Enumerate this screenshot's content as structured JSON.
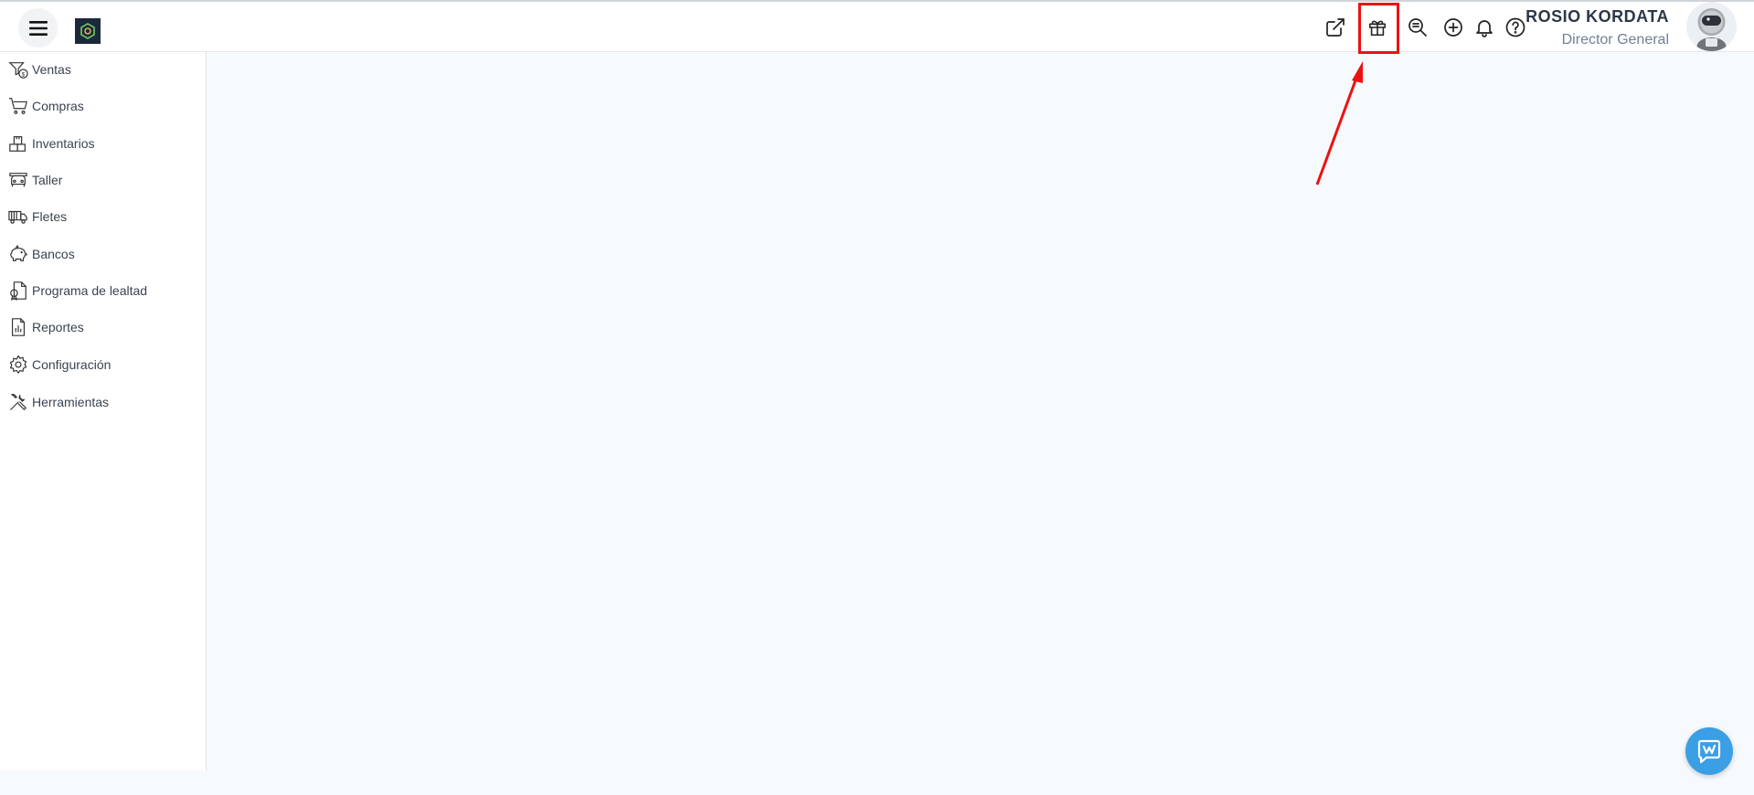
{
  "header": {
    "user_name": "ROSIO KORDATA",
    "user_role": "Director General",
    "icons": [
      "external-link-icon",
      "gift-icon",
      "search-zoom-icon",
      "add-circle-icon",
      "bell-icon",
      "help-icon"
    ]
  },
  "sidebar": {
    "items": [
      {
        "label": "Ventas",
        "icon": "sales-icon"
      },
      {
        "label": "Compras",
        "icon": "cart-icon"
      },
      {
        "label": "Inventarios",
        "icon": "boxes-icon"
      },
      {
        "label": "Taller",
        "icon": "car-icon"
      },
      {
        "label": "Fletes",
        "icon": "truck-icon"
      },
      {
        "label": "Bancos",
        "icon": "piggy-bank-icon"
      },
      {
        "label": "Programa de lealtad",
        "icon": "loyalty-icon"
      },
      {
        "label": "Reportes",
        "icon": "report-icon"
      },
      {
        "label": "Configuración",
        "icon": "gear-icon"
      },
      {
        "label": "Herramientas",
        "icon": "tools-icon"
      }
    ]
  },
  "colors": {
    "annotation": "#ee1111",
    "chat_button": "#3b9fe6",
    "background": "#f7fafc"
  }
}
